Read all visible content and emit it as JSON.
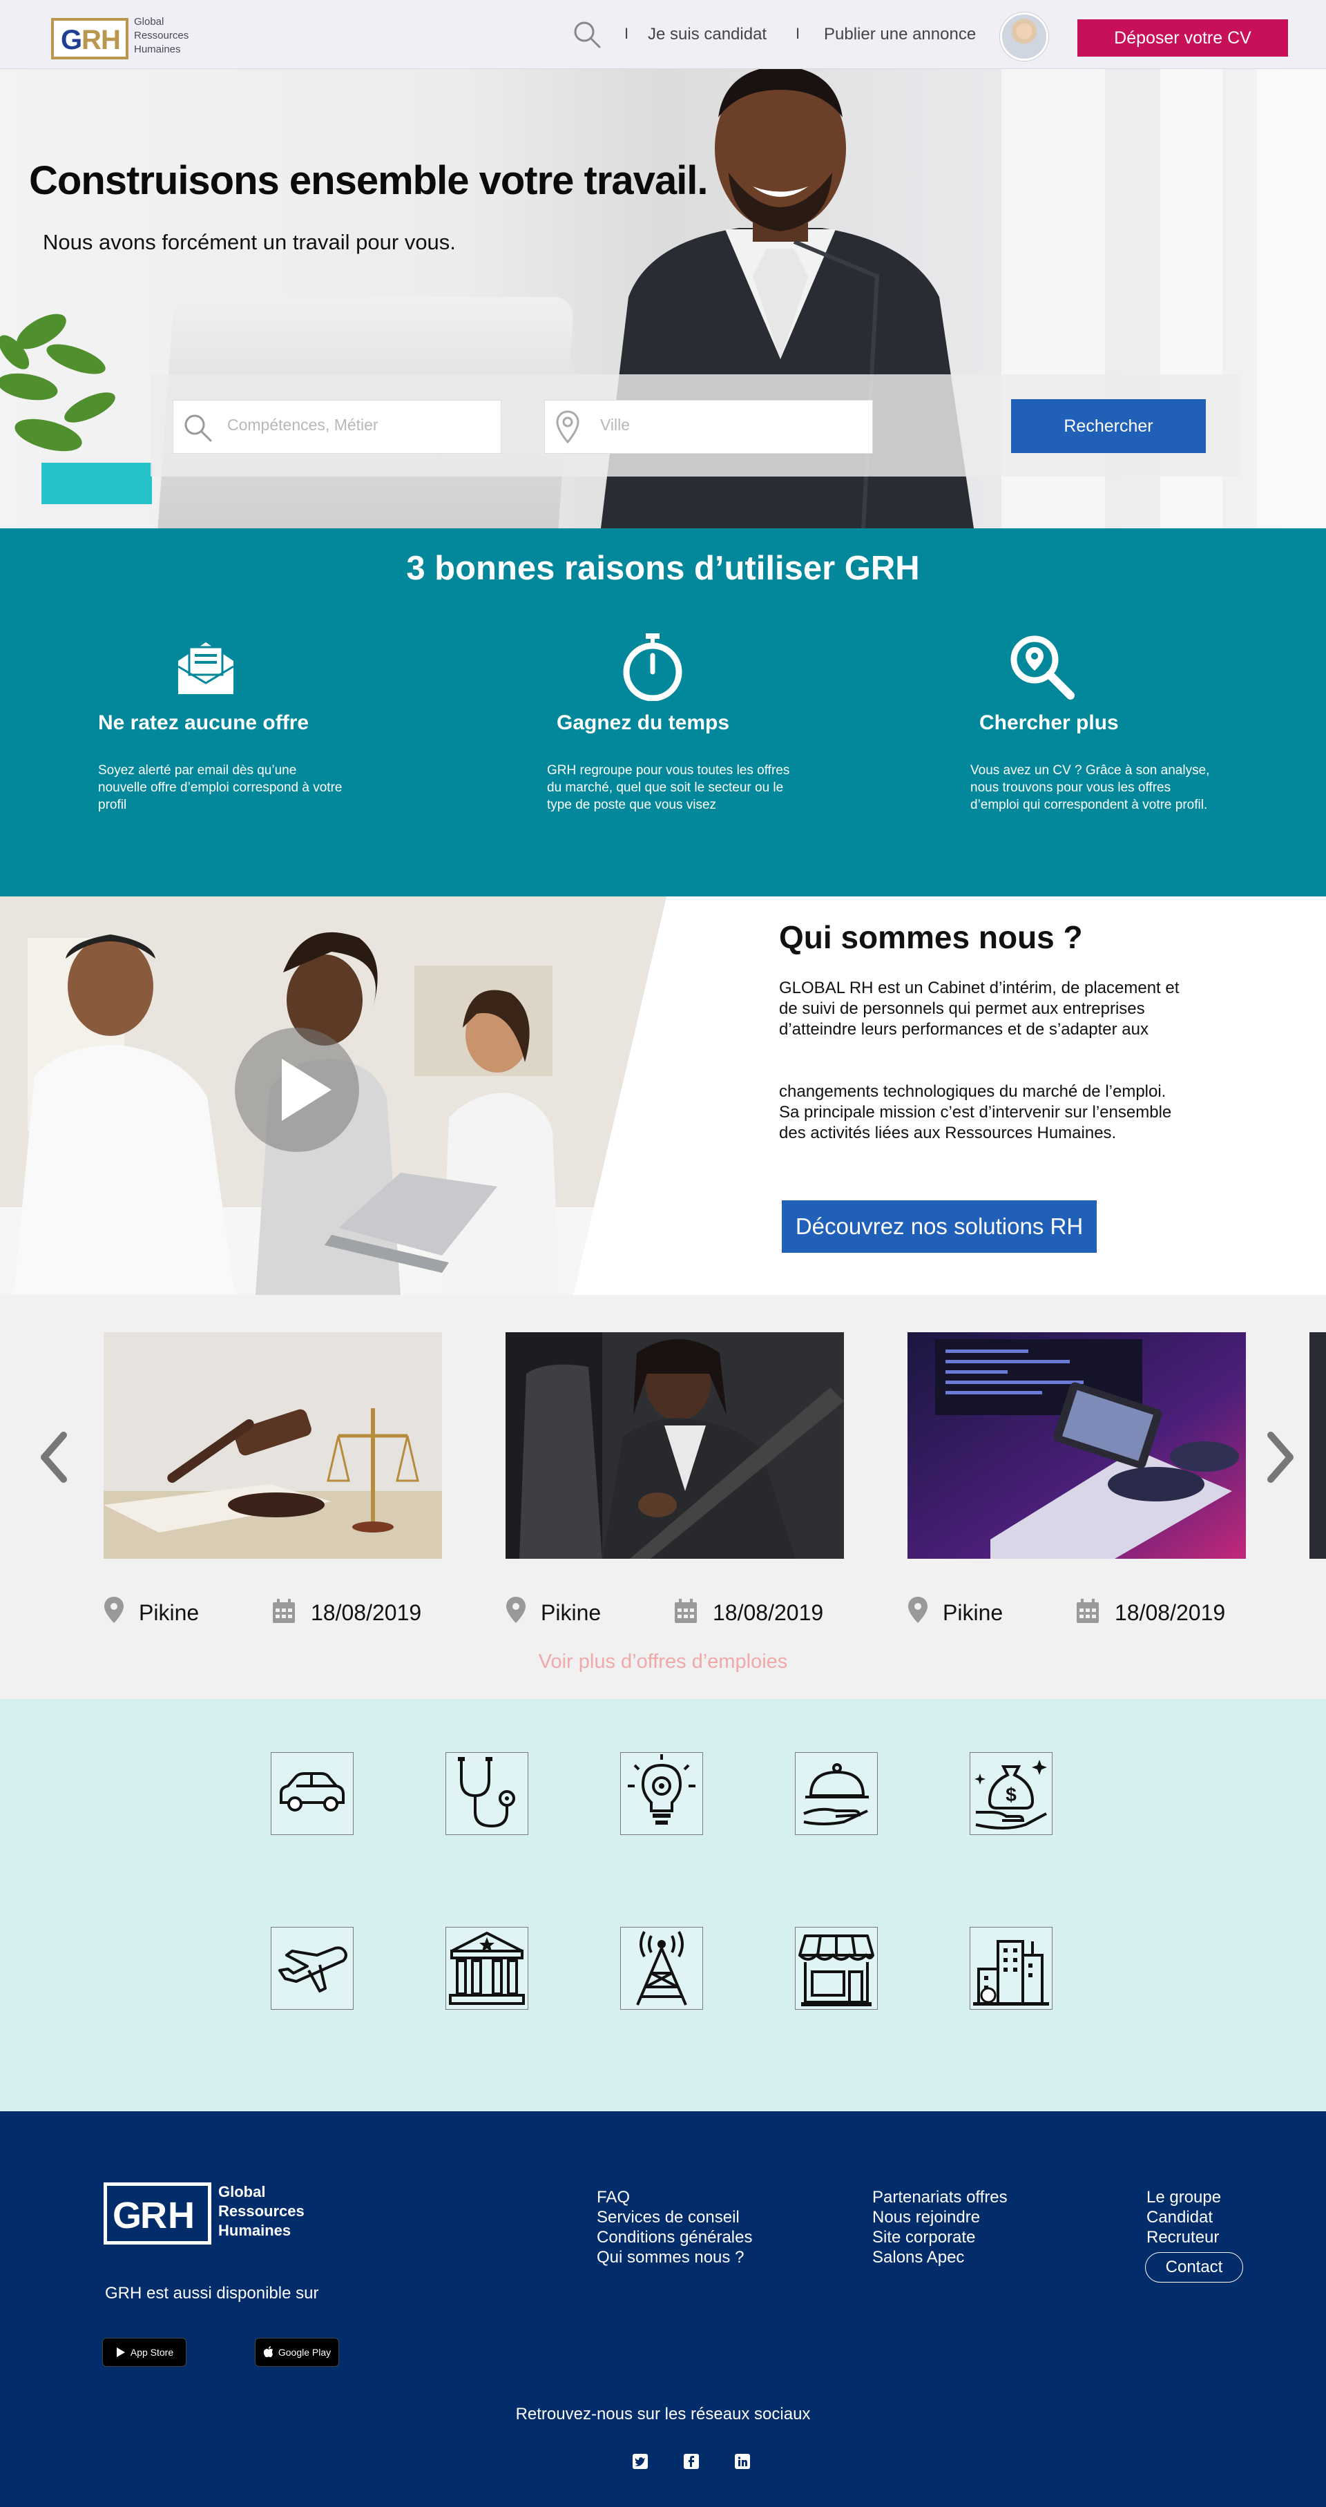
{
  "header": {
    "logo_letters": "GRH",
    "logo_line1": "Global",
    "logo_line2": "Ressources",
    "logo_line3": "Humaines",
    "separator": "I",
    "link_candidate": "Je suis candidat",
    "link_publish": "Publier une annonce",
    "cta": "Déposer votre CV",
    "icons": [
      "search-icon",
      "avatar"
    ]
  },
  "hero": {
    "title": "Construisons ensemble votre travail.",
    "subtitle": "Nous avons forcément un travail pour vous.",
    "search_placeholder": "Compétences, Métier",
    "city_placeholder": "Ville",
    "search_button": "Rechercher"
  },
  "reasons": {
    "title": "3 bonnes raisons d’utiliser GRH",
    "items": [
      {
        "icon": "email-alert-icon",
        "title": "Ne ratez aucune offre",
        "text": "Soyez alerté par email dès qu’une nouvelle offre d’emploi correspond à votre profil"
      },
      {
        "icon": "stopwatch-icon",
        "title": "Gagnez du temps",
        "text": "GRH regroupe pour vous toutes les offres du marché, quel que soit le secteur ou le type de poste que vous visez"
      },
      {
        "icon": "search-location-icon",
        "title": "Chercher plus",
        "text": "Vous avez un CV ? Grâce à son analyse, nous trouvons pour vous les offres d’emploi qui correspondent à votre profil."
      }
    ]
  },
  "about": {
    "title": "Qui sommes nous ?",
    "p1": "GLOBAL RH est un Cabinet d’intérim, de placement et de suivi de personnels qui permet aux entreprises d’atteindre leurs performances et de s’adapter aux",
    "p2": "changements technologiques du marché de l’emploi. Sa principale mission c’est d’intervenir sur l’ensemble des activités liées aux Ressources Humaines.",
    "button": "Découvrez nos solutions RH"
  },
  "offers": {
    "items": [
      {
        "image": "law-gavel-photo",
        "location": "Pikine",
        "date": "18/08/2019"
      },
      {
        "image": "driver-seatbelt-photo",
        "location": "Pikine",
        "date": "18/08/2019"
      },
      {
        "image": "developer-code-photo",
        "location": "Pikine",
        "date": "18/08/2019"
      }
    ],
    "more_link": "Voir plus d’offres d’emploies"
  },
  "sectors": {
    "icons": [
      "car-icon",
      "stethoscope-icon",
      "lightbulb-gear-icon",
      "food-service-icon",
      "money-bag-hand-icon",
      "airplane-icon",
      "bank-building-icon",
      "antenna-tower-icon",
      "shop-icon",
      "city-buildings-icon"
    ]
  },
  "footer": {
    "logo_letters": "GRH",
    "logo_line1": "Global",
    "logo_line2": "Ressources",
    "logo_line3": "Humaines",
    "available_on": "GRH est aussi disponible sur",
    "store1": "App Store",
    "store2": "Google Play",
    "col1": [
      "FAQ",
      "Services de conseil",
      "Conditions générales",
      "Qui sommes nous ?"
    ],
    "col2": [
      "Partenariats offres",
      "Nous rejoindre",
      "Site corporate",
      "Salons Apec"
    ],
    "col3": [
      "Le groupe",
      "Candidat",
      "Recruteur"
    ],
    "contact": "Contact",
    "social_title": "Retrouvez-nous sur les réseaux sociaux",
    "social": [
      "twitter-icon",
      "facebook-icon",
      "linkedin-icon"
    ]
  },
  "colors": {
    "brand_gold": "#b9974f",
    "brand_blue": "#1f3f93",
    "cta_pink": "#c8105a",
    "button_blue": "#2060b8",
    "teal": "#03879a",
    "footer_navy": "#032c6a",
    "sector_bg": "#d6f0f2"
  }
}
